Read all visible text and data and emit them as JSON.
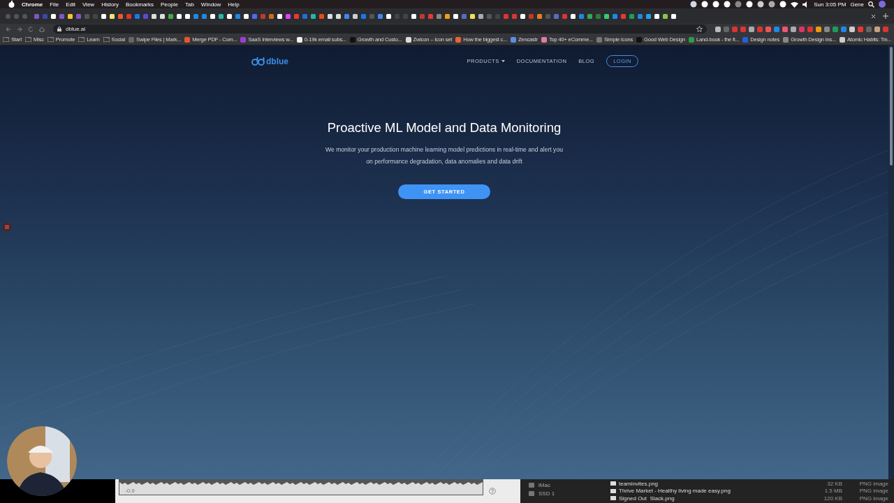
{
  "menu_bar": {
    "app": "Chrome",
    "menus": [
      "File",
      "Edit",
      "View",
      "History",
      "Bookmarks",
      "People",
      "Tab",
      "Window",
      "Help"
    ],
    "clock": "Sun 3:05 PM",
    "user": "Gene"
  },
  "browser": {
    "address": "dblue.ai",
    "bookmarks": [
      {
        "label": "Start",
        "kind": "folder"
      },
      {
        "label": "Misc",
        "kind": "folder"
      },
      {
        "label": "Promote",
        "kind": "folder"
      },
      {
        "label": "Learn",
        "kind": "folder"
      },
      {
        "label": "Social",
        "kind": "folder"
      },
      {
        "label": "Swipe Files | Mark...",
        "kind": "link",
        "color": "#666666"
      },
      {
        "label": "Merge PDF - Com...",
        "kind": "link",
        "color": "#e4572e"
      },
      {
        "label": "SaaS Interviews w...",
        "kind": "link",
        "color": "#9b3fd1"
      },
      {
        "label": "0-19k email subs...",
        "kind": "link",
        "color": "#eeeeee"
      },
      {
        "label": "Growth and Custo...",
        "kind": "link",
        "color": "#111111"
      },
      {
        "label": "Zwicon – Icon set",
        "kind": "link",
        "color": "#dddddd"
      },
      {
        "label": "How the biggest c...",
        "kind": "link",
        "color": "#e8623a"
      },
      {
        "label": "Zencastr",
        "kind": "link",
        "color": "#5b8fe0"
      },
      {
        "label": "Top 40+ eComme...",
        "kind": "link",
        "color": "#e27aa8"
      },
      {
        "label": "Simple Icons",
        "kind": "link",
        "color": "#777777"
      },
      {
        "label": "Good Web Design",
        "kind": "link",
        "color": "#111111"
      },
      {
        "label": "Land-book - the fi...",
        "kind": "link",
        "color": "#2e9a4e"
      },
      {
        "label": "Design notes",
        "kind": "link",
        "color": "#2360e0"
      },
      {
        "label": "Growth Design Ins...",
        "kind": "link",
        "color": "#888888"
      },
      {
        "label": "Atomic Habits: Tin...",
        "kind": "link",
        "color": "#cccccc"
      }
    ]
  },
  "page": {
    "logo": "dblue",
    "nav": [
      {
        "label": "PRODUCTS",
        "kind": "dropdown"
      },
      {
        "label": "DOCUMENTATION",
        "kind": "link"
      },
      {
        "label": "BLOG",
        "kind": "link"
      },
      {
        "label": "LOGIN",
        "kind": "button"
      }
    ],
    "hero": {
      "title": "Proactive ML Model and Data Monitoring",
      "subtitle": "We monitor your production machine learning model predictions in real-time and alert you on performance degradation, data anomalies and data drift",
      "cta": "GET STARTED"
    }
  },
  "audio_editor": {
    "reading": "-0.9"
  },
  "finder": {
    "devices": [
      "iMac",
      "SSD 1"
    ],
    "files": [
      {
        "name": "teaminvites.png",
        "size": "32 KB",
        "type": "PNG image"
      },
      {
        "name": "Thrive Market - Healthy living made easy.png",
        "size": "1.5 MB",
        "type": "PNG image"
      },
      {
        "name": "Signed Out  Slack.png",
        "size": "120 KB",
        "type": "PNG image"
      }
    ]
  }
}
